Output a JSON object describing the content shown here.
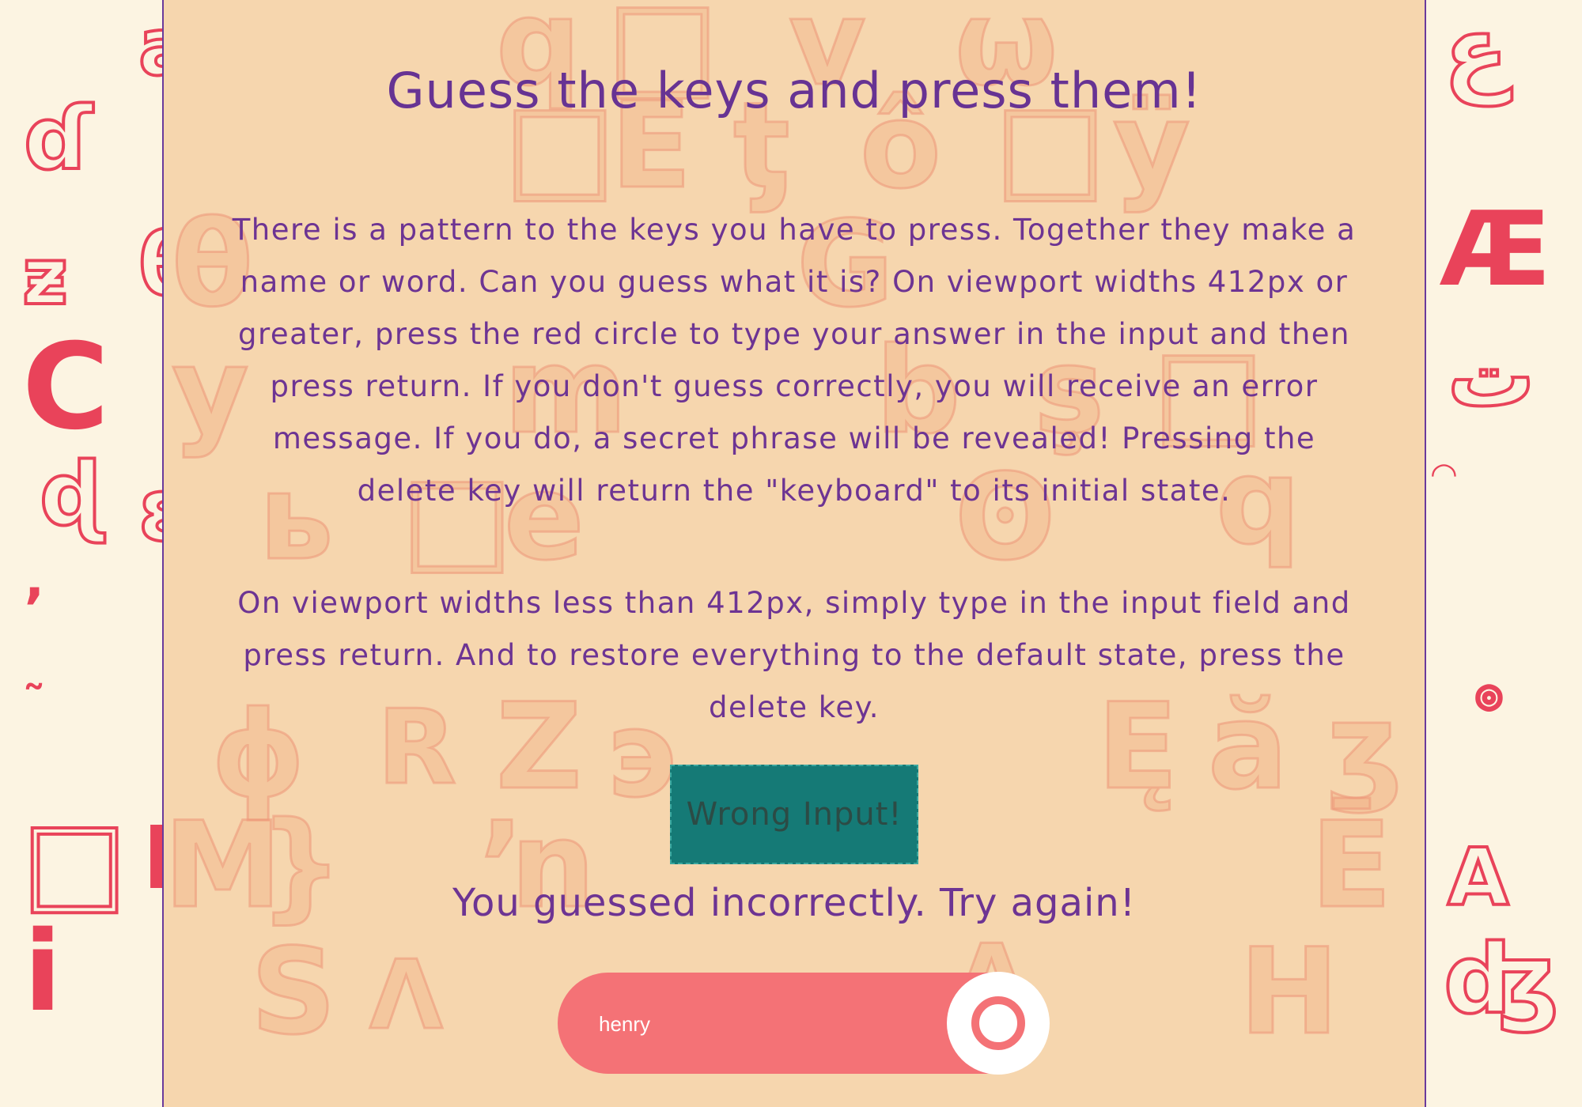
{
  "page": {
    "title": "Guess the keys and press them!",
    "paragraph1": "There is a pattern to the keys you have to press. Together they make a name or word. Can you guess what it is? On viewport widths 412px or greater, press the red circle to type your answer in the input and then press return. If you don't guess correctly, you will receive an error message. If you do, a secret phrase will be revealed! Pressing the delete key will return the \"keyboard\" to its initial state.",
    "paragraph2": "On viewport widths less than 412px, simply type in the input field and press return. And to restore everything to the default state, press the delete key.",
    "wrong_button": "Wrong Input!",
    "message": "You guessed incorrectly. Try again!",
    "input_value": "henry"
  },
  "colors": {
    "accent": "#673393",
    "panel": "#f6d6ae",
    "input": "#f47276",
    "button": "#157a76",
    "glyph": "#e9435a"
  }
}
